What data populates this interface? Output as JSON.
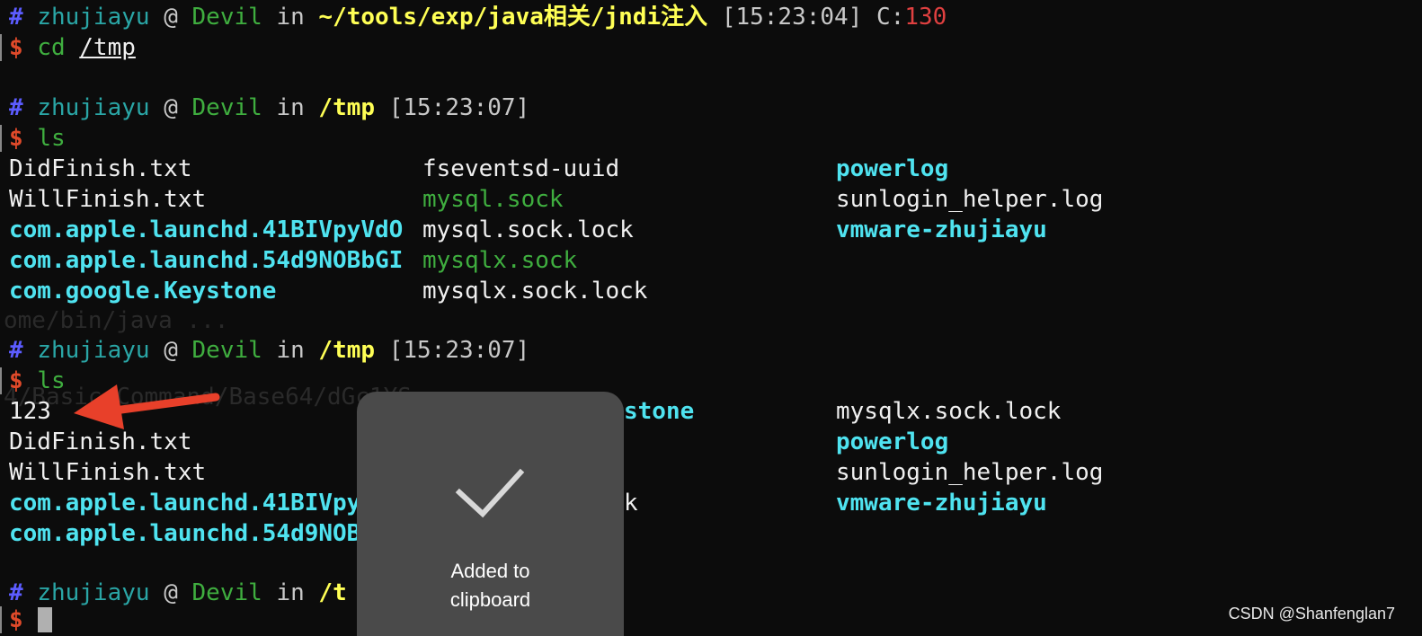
{
  "prompts": [
    {
      "hash": "#",
      "user": "zhujiayu",
      "at": "@",
      "host": "Devil",
      "in": "in",
      "dir": "~/tools/exp/java相关/jndi注入",
      "time": "[15:23:04]",
      "c_label": "C:",
      "c_value": "130"
    },
    {
      "hash": "#",
      "user": "zhujiayu",
      "at": "@",
      "host": "Devil",
      "in": "in",
      "dir": "/tmp",
      "time": "[15:23:07]"
    },
    {
      "hash": "#",
      "user": "zhujiayu",
      "at": "@",
      "host": "Devil",
      "in": "in",
      "dir": "/tmp",
      "time": "[15:23:07]"
    },
    {
      "hash": "#",
      "user": "zhujiayu",
      "at": "@",
      "host": "Devil",
      "in": "in",
      "dir": "/t"
    }
  ],
  "commands": [
    {
      "dollar": "$",
      "cmd": "cd",
      "arg": "/tmp"
    },
    {
      "dollar": "$",
      "cmd": "ls"
    },
    {
      "dollar": "$",
      "cmd": "ls"
    },
    {
      "dollar": "$"
    }
  ],
  "ls1": {
    "col1": [
      "DidFinish.txt",
      "WillFinish.txt",
      "com.apple.launchd.41BIVpyVdO",
      "com.apple.launchd.54d9NOBbGI",
      "com.google.Keystone"
    ],
    "col2": [
      "fseventsd-uuid",
      "mysql.sock",
      "mysql.sock.lock",
      "mysqlx.sock",
      "mysqlx.sock.lock"
    ],
    "col3": [
      "powerlog",
      "sunlogin_helper.log",
      "vmware-zhujiayu"
    ]
  },
  "ls2": {
    "col1": [
      "123",
      "DidFinish.txt",
      "WillFinish.txt",
      "com.apple.launchd.41BIVpy",
      "com.apple.launchd.54d9NOB"
    ],
    "col2": [
      "stone",
      "k"
    ],
    "col3": [
      "mysqlx.sock.lock",
      "powerlog",
      "sunlogin_helper.log",
      "vmware-zhujiayu"
    ]
  },
  "ghost": {
    "line1": "ome/bin/java ...",
    "line2": "4/Basic/Command/Base64/dGc1YS..."
  },
  "toast": {
    "message_line1": "Added to",
    "message_line2": "clipboard"
  },
  "watermark": "CSDN @Shanfenglan7",
  "colors": {
    "directory": "#4fe3f0",
    "socket": "#3fae3f",
    "prompt_dir": "#ffff55",
    "arrow": "#e8402a"
  }
}
